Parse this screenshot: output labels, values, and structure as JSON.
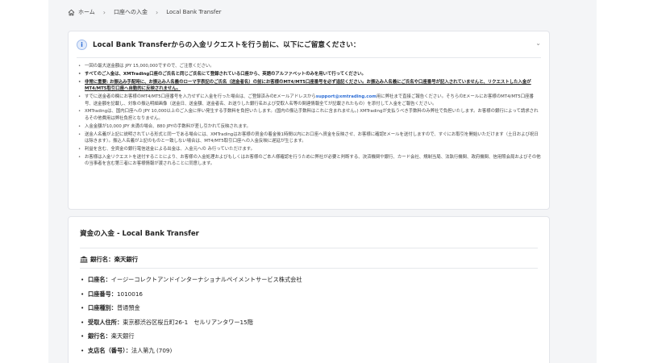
{
  "breadcrumb": {
    "home": "ホーム",
    "deposit": "口座への入金",
    "current": "Local Bank Transfer"
  },
  "notice": {
    "title": "Local Bank Transferからの入金リクエストを行う前に、以下にご留意ください：",
    "items": [
      "一回の最大送金額は JPY 15,000,000ですので、ご注意ください。",
      "すべてのご入金は、XMTrading口座のご氏名と同じご氏名にて登録されている口座から、英語のアルファベットのみを用いて行ってください。",
      "非常に重要: お振込み手配時に、お振込み人名義のローマ字表記のご氏名（送金者名）の前にお客様のMT4/MT5口座番号を必ず追記ください。お振込み人名義にご氏名や口座番号が記入されていませんと、リクエストした入金がMT4/MT5取引口座へ自動的に反映されません。",
      "すでに送金者の欄にお客様のMT4/MT5口座番号を入力せずに入金を行った場合は、ご登録済みのEメールアドレスから",
      "用に弊社まで直接ご報告ください。そちらのEメールにお客様のMT4/MT5口座番号、送金額を記載し、対象の振込明細画像（送金日、送金額、送金者名、お送りした銀行名および受取人名等の関連情報全てが記載されたもの）を添付して入金をご報告ください。",
      "XMTradingは、国内口座への JPY 10,000以上のご入金に伴い発生する手数料を負担いたします。(国内の振込手数料はこれに含まれません。) XMTradingが支払うべき手数料のみ弊社で負担いたします。お客様の銀行によって請求されるその他費用は弊社負担となりません。",
      "入金金額が10,000 JPY 未満の場合、880 JPYの手数料が差し引かれて反映されます。",
      "送金人名義が上記に説明されている形式と同一である場合には、XMTradingはお客様の資金の着金後1時間以内にお口座へ資金を反映させ、お客様に確認Eメールを送付しますので、すぐにお取引を開始いただけます（土日および祝日は除きます）。振込人名義が上記のものと一致しない場合は、MT4/MT5取引口座への入金反映に遅延が生じます。",
      "利益を含む、全資金の銀行電信送金による出金は、入金元への み行っていただけます。",
      "お客様は入金リクエストを送付することにより、お客様の入金処理およびもしくはお客様のご本人様確認を行うために弊社が必要と判断する、決済機関や銀行、カード会社、規制当局、法執行機関、政府機関、信用照会局およびその他の当事者を含む第三者にお客様情報が渡されることに同意します。"
    ],
    "support_email": "support@xmtrading.com"
  },
  "deposit": {
    "title": "資金の入金 - Local Bank Transfer",
    "bank_label": "銀行名：楽天銀行",
    "fields": [
      {
        "key": "口座名：",
        "value": "イージーコレクトアンドインターナショナルペイメントサービス株式会社"
      },
      {
        "key": "口座番号：",
        "value": "1010016"
      },
      {
        "key": "口座種別：",
        "value": "普通預金"
      },
      {
        "key": "受取人住所：",
        "value": "東京都渋谷区桜丘町26-1　セルリアンタワー15階"
      },
      {
        "key": "銀行名：",
        "value": "楽天銀行"
      },
      {
        "key": "支店名（番号）：",
        "value": "法人第九 (709)"
      }
    ]
  }
}
